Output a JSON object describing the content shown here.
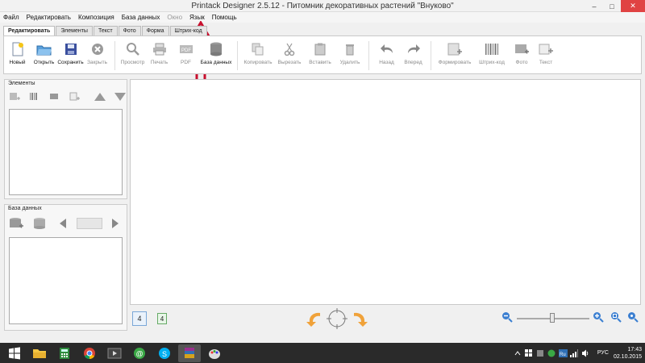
{
  "window": {
    "title": "Printack Designer 2.5.12 - Питомник декоративных растений \"Внуково\"",
    "minimize": "–",
    "maximize": "□",
    "close": "✕"
  },
  "menu": [
    {
      "label": "Файл",
      "enabled": true
    },
    {
      "label": "Редактировать",
      "enabled": true
    },
    {
      "label": "Композиция",
      "enabled": true
    },
    {
      "label": "База данных",
      "enabled": true
    },
    {
      "label": "Окно",
      "enabled": false
    },
    {
      "label": "Язык",
      "enabled": true
    },
    {
      "label": "Помощь",
      "enabled": true
    }
  ],
  "tabs": [
    "Редактировать",
    "Элементы",
    "Текст",
    "Фото",
    "Форма",
    "Штрих-код"
  ],
  "toolbar": {
    "new": "Новый",
    "open": "Открыть",
    "save": "Сохранить",
    "close": "Закрыть",
    "preview": "Просмотр",
    "print": "Печать",
    "pdf": "PDF",
    "database": "База данных",
    "copy": "Копировать",
    "cut": "Вырезать",
    "paste": "Вставить",
    "delete": "Удалить",
    "back": "Назад",
    "forward": "Вперед",
    "format": "Формировать",
    "barcode": "Штрих-код",
    "photo": "Фото",
    "text": "Текст"
  },
  "panels": {
    "elements": {
      "title": "Элементы"
    },
    "database": {
      "title": "База данных"
    }
  },
  "bottom": {
    "page_current": "4",
    "page_next": "4"
  },
  "taskbar": {
    "language": "РУС",
    "time": "17:43",
    "date": "02.10.2015"
  },
  "colors": {
    "accent_red": "#c8102e",
    "close_button": "#e04343",
    "taskbar": "#2a2a2a"
  }
}
